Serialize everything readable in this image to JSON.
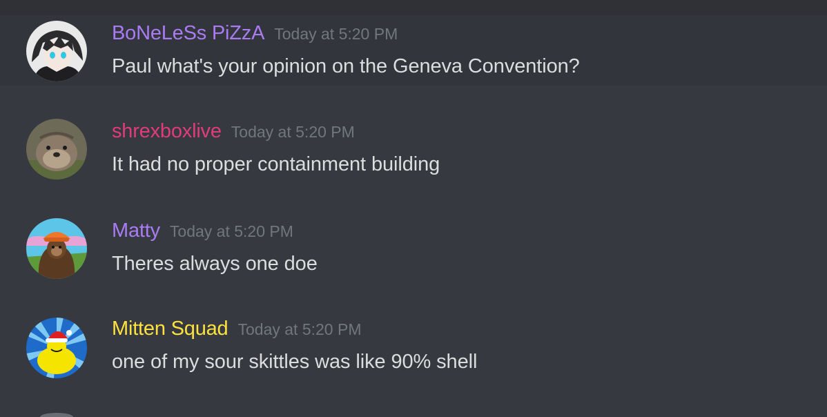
{
  "messages": [
    {
      "username": "BoNeLeSs PiZzA",
      "username_color": "#a97cf3",
      "timestamp": "Today at 5:20 PM",
      "content": "Paul what's your opinion on the Geneva Convention?",
      "avatar": "anime-boy-avatar"
    },
    {
      "username": "shrexboxlive",
      "username_color": "#e13c7a",
      "timestamp": "Today at 5:20 PM",
      "content": "It had no proper containment building",
      "avatar": "otter-avatar"
    },
    {
      "username": "Matty",
      "username_color": "#a97cf3",
      "timestamp": "Today at 5:20 PM",
      "content": "Theres always one doe",
      "avatar": "bigfoot-avatar"
    },
    {
      "username": "Mitten Squad",
      "username_color": "#ffe23f",
      "timestamp": "Today at 5:20 PM",
      "content": "one of my sour skittles was like 90% shell",
      "avatar": "santa-duck-avatar"
    }
  ]
}
